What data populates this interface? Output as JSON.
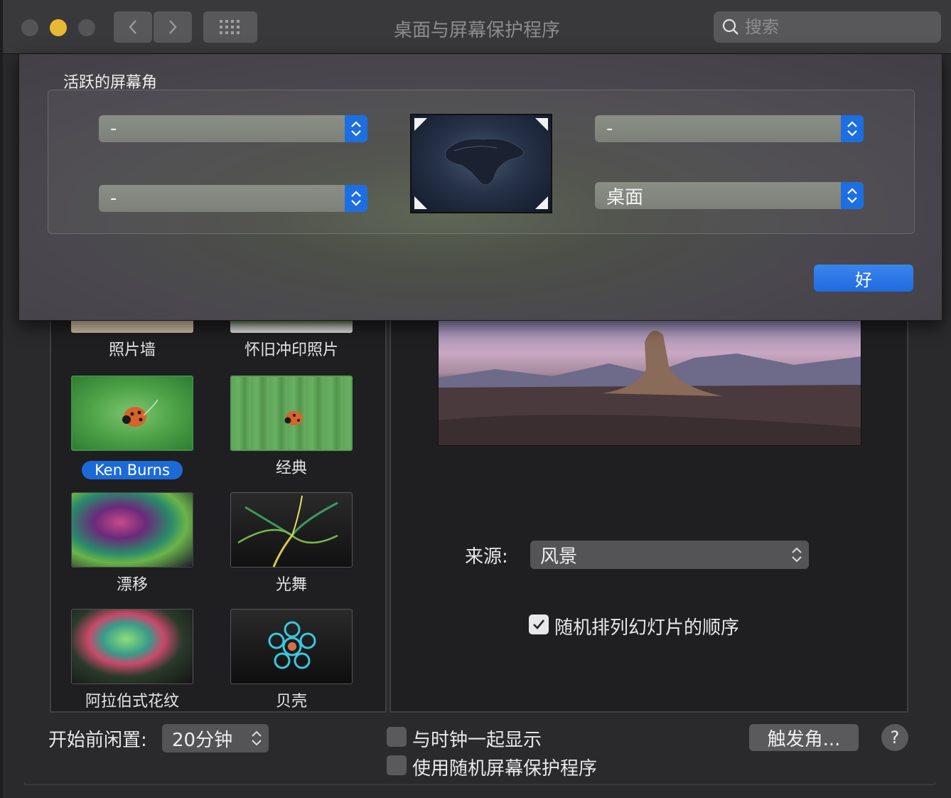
{
  "window": {
    "title": "桌面与屏幕保护程序",
    "search_placeholder": "搜索"
  },
  "screensavers": [
    {
      "label": "照片墙"
    },
    {
      "label": "怀旧冲印照片"
    },
    {
      "label": "Ken Burns",
      "selected": true
    },
    {
      "label": "经典"
    },
    {
      "label": "漂移"
    },
    {
      "label": "光舞"
    },
    {
      "label": "阿拉伯式花纹"
    },
    {
      "label": "贝壳"
    }
  ],
  "options": {
    "source_label": "来源:",
    "source_value": "风景",
    "shuffle_label": "随机排列幻灯片的顺序",
    "shuffle_checked": true,
    "idle_label": "开始前闲置:",
    "idle_value": "20分钟",
    "show_clock_label": "与时钟一起显示",
    "random_label": "使用随机屏幕保护程序",
    "hot_corners_button": "触发角...",
    "help": "?"
  },
  "hot_corners": {
    "title": "活跃的屏幕角",
    "top_left": "-",
    "top_right": "-",
    "bottom_left": "-",
    "bottom_right": "桌面",
    "ok_button": "好"
  },
  "colors": {
    "accent": "#1f6be0",
    "minimize": "#e9b935"
  }
}
